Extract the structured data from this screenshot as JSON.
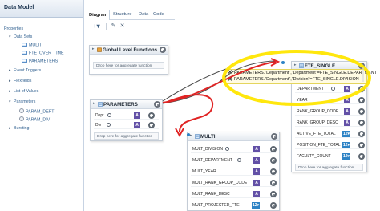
{
  "left_panel": {
    "title": "Data Model",
    "tree": [
      {
        "label": "Properties",
        "kind": "root"
      },
      {
        "label": "Data Sets",
        "kind": "folder",
        "twisty": "▾"
      },
      {
        "label": "MULTI",
        "kind": "dataset"
      },
      {
        "label": "FTE_OVER_TIME",
        "kind": "dataset"
      },
      {
        "label": "PARAMETERS",
        "kind": "dataset"
      },
      {
        "label": "Event Triggers",
        "kind": "folder",
        "twisty": "▸"
      },
      {
        "label": "Flexfields",
        "kind": "folder",
        "twisty": "▸"
      },
      {
        "label": "List of Values",
        "kind": "folder",
        "twisty": "▸"
      },
      {
        "label": "Parameters",
        "kind": "folder",
        "twisty": "▾"
      },
      {
        "label": "PARAM_DEPT",
        "kind": "param"
      },
      {
        "label": "PARAM_DIV",
        "kind": "param"
      },
      {
        "label": "Bursting",
        "kind": "folder",
        "twisty": "▸"
      }
    ]
  },
  "tabs": [
    {
      "label": "Diagram",
      "active": true
    },
    {
      "label": "Structure",
      "active": false
    },
    {
      "label": "Data",
      "active": false
    },
    {
      "label": "Code",
      "active": false
    }
  ],
  "toolbar": {
    "add_label": "+▾",
    "edit_icon": "pencil-icon",
    "delete_icon": "close-icon"
  },
  "datasets": {
    "global": {
      "title": "Global Level Functions",
      "drop_text": "Drop here for aggregate function"
    },
    "parameters": {
      "title": "PARAMETERS",
      "fields": [
        {
          "label": "Dept",
          "badge": "A"
        },
        {
          "label": "Div",
          "badge": "A"
        }
      ],
      "drop_text": "Drop here for aggregate function"
    },
    "fte_single": {
      "title": "FTE_SINGLE",
      "fields": [
        {
          "label": "DEPARTMENT",
          "badge": "A",
          "link": true
        },
        {
          "label": "YEAR",
          "badge": "A",
          "link": false
        },
        {
          "label": "RANK_GROUP_CODE",
          "badge": "A",
          "link": false
        },
        {
          "label": "RANK_GROUP_DESC",
          "badge": "A",
          "link": false
        },
        {
          "label": "ACTIVE_FTE_TOTAL",
          "badge": "12▾",
          "link": false
        },
        {
          "label": "POSITION_FTE_TOTAL",
          "badge": "12▾",
          "link": false
        },
        {
          "label": "FACULTY_COUNT",
          "badge": "12▾",
          "link": false
        }
      ],
      "drop_text": "Drop here for aggregate function"
    },
    "multi": {
      "title": "MULTI",
      "fields": [
        {
          "label": "MULT_DIVISION",
          "badge": "A",
          "link": true
        },
        {
          "label": "MULT_DEPARTMENT",
          "badge": "A",
          "link": true
        },
        {
          "label": "MULT_YEAR",
          "badge": "A",
          "link": false
        },
        {
          "label": "MULT_RANK_GROUP_CODE",
          "badge": "A",
          "link": false
        },
        {
          "label": "MULT_RANK_DESC",
          "badge": "A",
          "link": false
        },
        {
          "label": "MULT_PROJECTED_FTE",
          "badge": "12▾",
          "link": false
        }
      ]
    }
  },
  "link_tooltip": {
    "lines": [
      "PARAMETERS.\"Department\",\"Department\"=FTE_SINGLE.DEPARTMENT",
      "PARAMETERS.\"Department\",\"Division\"=FTE_SINGLE.DIVISION"
    ]
  },
  "annotation_colors": {
    "highlight": "#ffe600",
    "arrow": "#e02424"
  }
}
